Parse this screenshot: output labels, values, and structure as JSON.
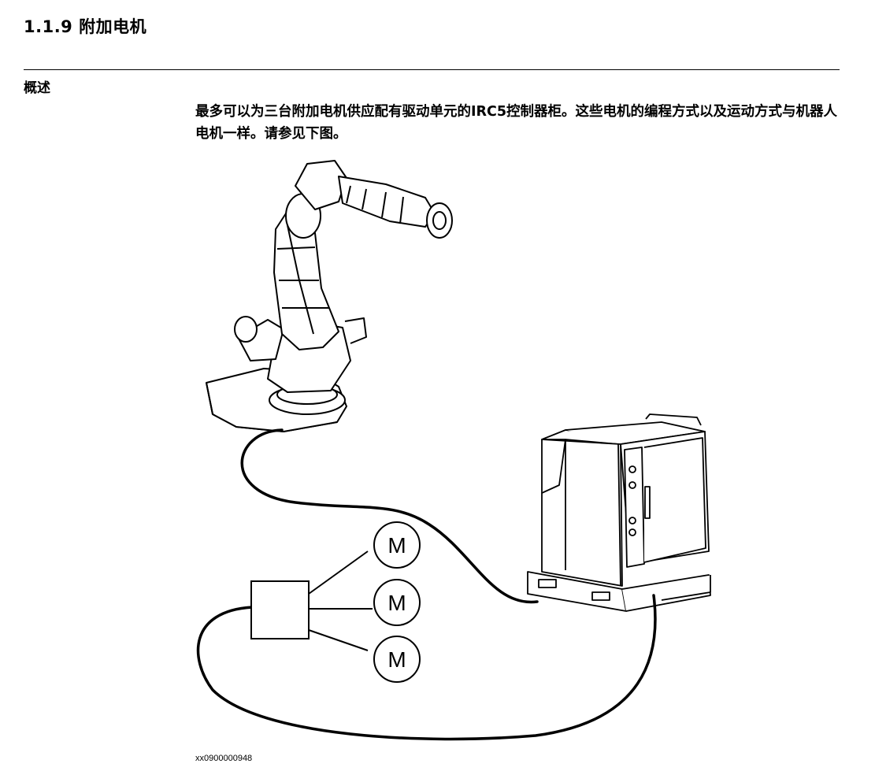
{
  "section": {
    "title": "1.1.9 附加电机",
    "side_heading": "概述"
  },
  "body": {
    "paragraph": "最多可以为三台附加电机供应配有驱动单元的IRC5控制器柜。这些电机的编程方式以及运动方式与机器人电机一样。请参见下图。"
  },
  "figure": {
    "motor_label": "M",
    "motor_labels": [
      "M",
      "M",
      "M"
    ],
    "figure_id": "xx0900000948"
  }
}
